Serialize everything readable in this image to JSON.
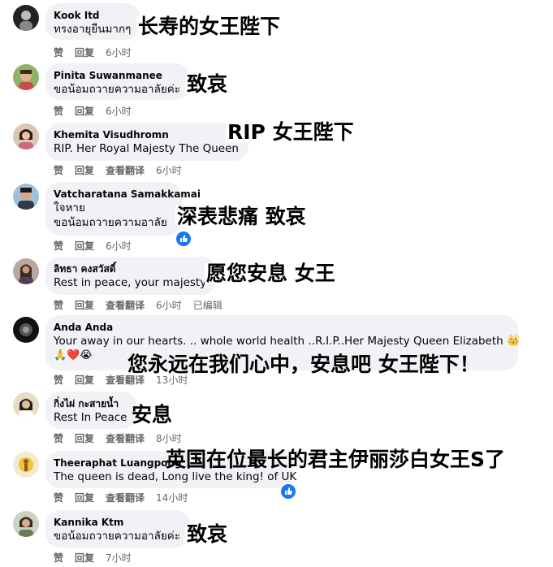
{
  "comments": [
    {
      "name": "Kook Itd",
      "lines": [
        "ทรงอายุยืนมากๆ"
      ],
      "actions": [
        "赞",
        "回复"
      ],
      "time": "6小时",
      "translation": "长寿的女王陛下"
    },
    {
      "name": "Pinita Suwanmanee",
      "lines": [
        "ขอน้อมถวายความอาลัยค่ะ"
      ],
      "actions": [
        "赞",
        "回复"
      ],
      "time": "6小时",
      "translation": "致哀"
    },
    {
      "name": "Khemita Visudhromn",
      "lines": [
        "RIP. Her Royal Majesty The Queen"
      ],
      "actions": [
        "赞",
        "回复",
        "查看翻译"
      ],
      "time": "6小时",
      "translation": "RIP 女王陛下"
    },
    {
      "name": "Vatcharatana Samakkamai",
      "lines": [
        "ใจหาย",
        "ขอน้อมถวายความอาลัย"
      ],
      "actions": [
        "赞",
        "回复"
      ],
      "time": "6小时",
      "translation": "深表悲痛 致哀"
    },
    {
      "name": "ลิทธา คงสวัสดิ์",
      "lines": [
        "Rest in peace, your majesty"
      ],
      "actions": [
        "赞",
        "回复",
        "查看翻译"
      ],
      "time": "6小时",
      "edited": "已编辑",
      "translation": "愿您安息 女王"
    },
    {
      "name": "Anda Anda",
      "lines": [
        "Your away in our hearts. .. whole world health ..R.I.P..Her Majesty Queen Elizabeth"
      ],
      "emojis": [
        "👑",
        "🙏",
        "❤️",
        "😭"
      ],
      "actions": [
        "赞",
        "回复",
        "查看翻译"
      ],
      "time": "13小时",
      "translation": "您永远在我们心中，安息吧 女王陛下！"
    },
    {
      "name": "กิ่งไผ่ กะสายน้ำ",
      "lines": [
        "Rest In Peace"
      ],
      "actions": [
        "赞",
        "回复",
        "查看翻译"
      ],
      "time": "8小时",
      "translation": "安息"
    },
    {
      "name": "Theeraphat Luangpong",
      "lines": [
        "The queen is dead, Long live the king! of UK"
      ],
      "actions": [
        "赞",
        "回复",
        "查看翻译"
      ],
      "time": "14小时",
      "translation": "英国在位最长的君主伊丽莎白女王S了"
    },
    {
      "name": "Kannika Ktm",
      "lines": [
        "ขอน้อมถวายความอาลัยค่ะ"
      ],
      "actions": [
        "赞",
        "回复"
      ],
      "time": "7小时",
      "translation": "致哀"
    }
  ],
  "colors": {
    "bubble": "#f0f2f5",
    "action_text": "#65676b",
    "like_badge": "#1877f2",
    "heart": "#f33e58"
  }
}
